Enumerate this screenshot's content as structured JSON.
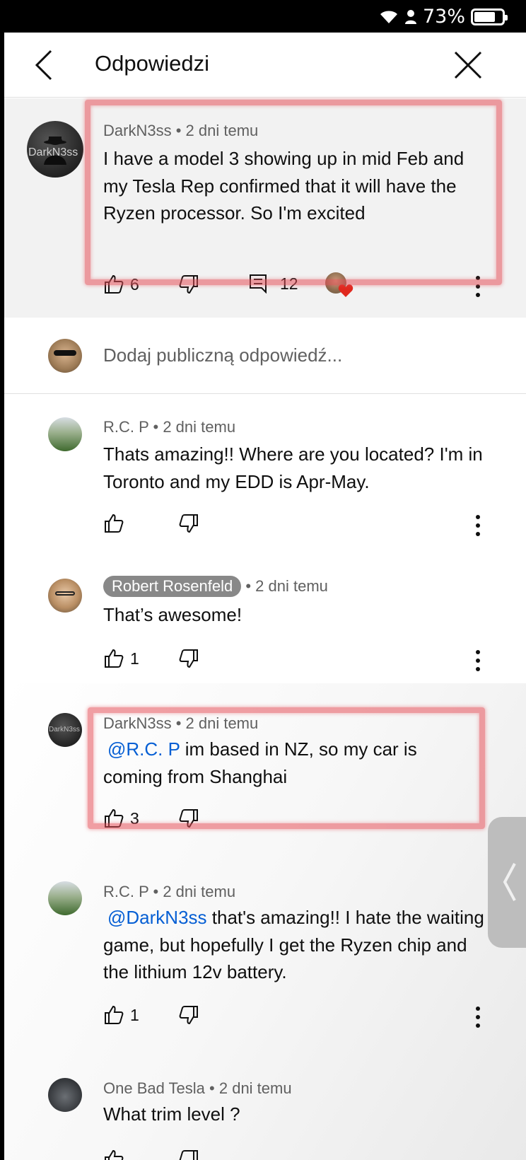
{
  "status_bar": {
    "battery": "73%",
    "icons": [
      "wifi-icon",
      "person-icon",
      "battery-icon"
    ]
  },
  "header": {
    "title": "Odpowiedzi",
    "back_icon": "chevron-left-icon",
    "close_icon": "close-icon"
  },
  "parent_comment": {
    "author": "DarkN3ss",
    "time": "2 dni temu",
    "avatar_text": "DarkN3ss",
    "text": "I have a model 3 showing up in mid Feb and my Tesla Rep confirmed that it will have the Ryzen processor. So I'm excited",
    "likes": "6",
    "replies": "12"
  },
  "add_reply": {
    "placeholder": "Dodaj publiczną odpowiedź..."
  },
  "replies": [
    {
      "author": "R.C. P",
      "time": "2 dni temu",
      "text": "Thats amazing!!  Where are you located?  I'm in Toronto and my EDD is Apr-May.",
      "likes": ""
    },
    {
      "author": "Robert Rosenfeld",
      "time": "2 dni temu",
      "text": "That’s awesome!",
      "likes": "1"
    },
    {
      "author": "DarkN3ss",
      "time": "2 dni temu",
      "mention": "@R.C. P",
      "text": " im based in NZ, so my car is coming from Shanghai",
      "likes": "3",
      "avatar_text": "DarkN3ss"
    },
    {
      "author": "R.C. P",
      "time": "2 dni temu",
      "mention": "@DarkN3ss",
      "text": " that's amazing!!  I hate the waiting game, but hopefully I get the Ryzen chip and the lithium 12v battery.",
      "likes": "1"
    },
    {
      "author": "One Bad Tesla",
      "time": "2 dni temu",
      "text": "What trim level ?",
      "likes": ""
    }
  ],
  "colors": {
    "accent_link": "#065fd4",
    "highlight": "#e6505a",
    "parent_bg": "#f2f2f2"
  }
}
